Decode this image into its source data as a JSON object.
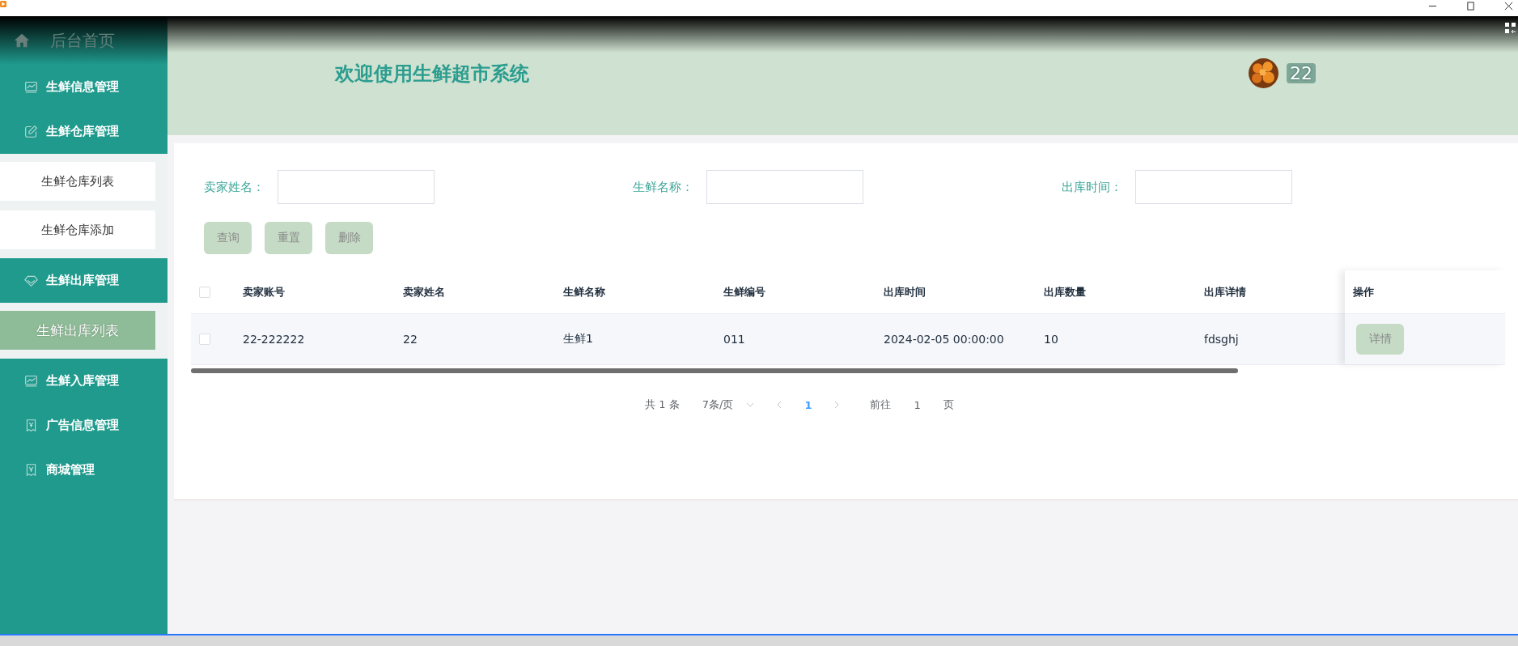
{
  "sidebar": {
    "home": "后台首页",
    "items": [
      {
        "label": "生鲜信息管理"
      },
      {
        "label": "生鲜仓库管理",
        "children": [
          {
            "label": "生鲜仓库列表",
            "selected": false
          },
          {
            "label": "生鲜仓库添加",
            "selected": false
          }
        ]
      },
      {
        "label": "生鲜出库管理",
        "children": [
          {
            "label": "生鲜出库列表",
            "selected": true
          }
        ]
      },
      {
        "label": "生鲜入库管理"
      },
      {
        "label": "广告信息管理"
      },
      {
        "label": "商城管理"
      }
    ]
  },
  "header": {
    "title": "欢迎使用生鲜超市系统",
    "user": "22"
  },
  "filters": [
    {
      "label": "卖家姓名："
    },
    {
      "label": "生鲜名称："
    },
    {
      "label": "出库时间："
    }
  ],
  "buttons": [
    "查询",
    "重置",
    "删除"
  ],
  "table": {
    "all_checked": false,
    "columns": [
      "卖家账号",
      "卖家姓名",
      "生鲜名称",
      "生鲜编号",
      "出库时间",
      "出库数量",
      "出库详情",
      "操作"
    ],
    "rows": [
      {
        "checked": false,
        "cells": [
          "22-222222",
          "22",
          "生鲜1",
          "011",
          "2024-02-05 00:00:00",
          "10",
          "fdsghj"
        ],
        "action": "详情"
      }
    ]
  },
  "pagination": {
    "total": "共 1 条",
    "page_size": "7条/页",
    "pages": [
      {
        "label": "1",
        "selected": true
      }
    ],
    "goto_label": "前往",
    "goto_value": "1",
    "goto_suffix": "页"
  }
}
